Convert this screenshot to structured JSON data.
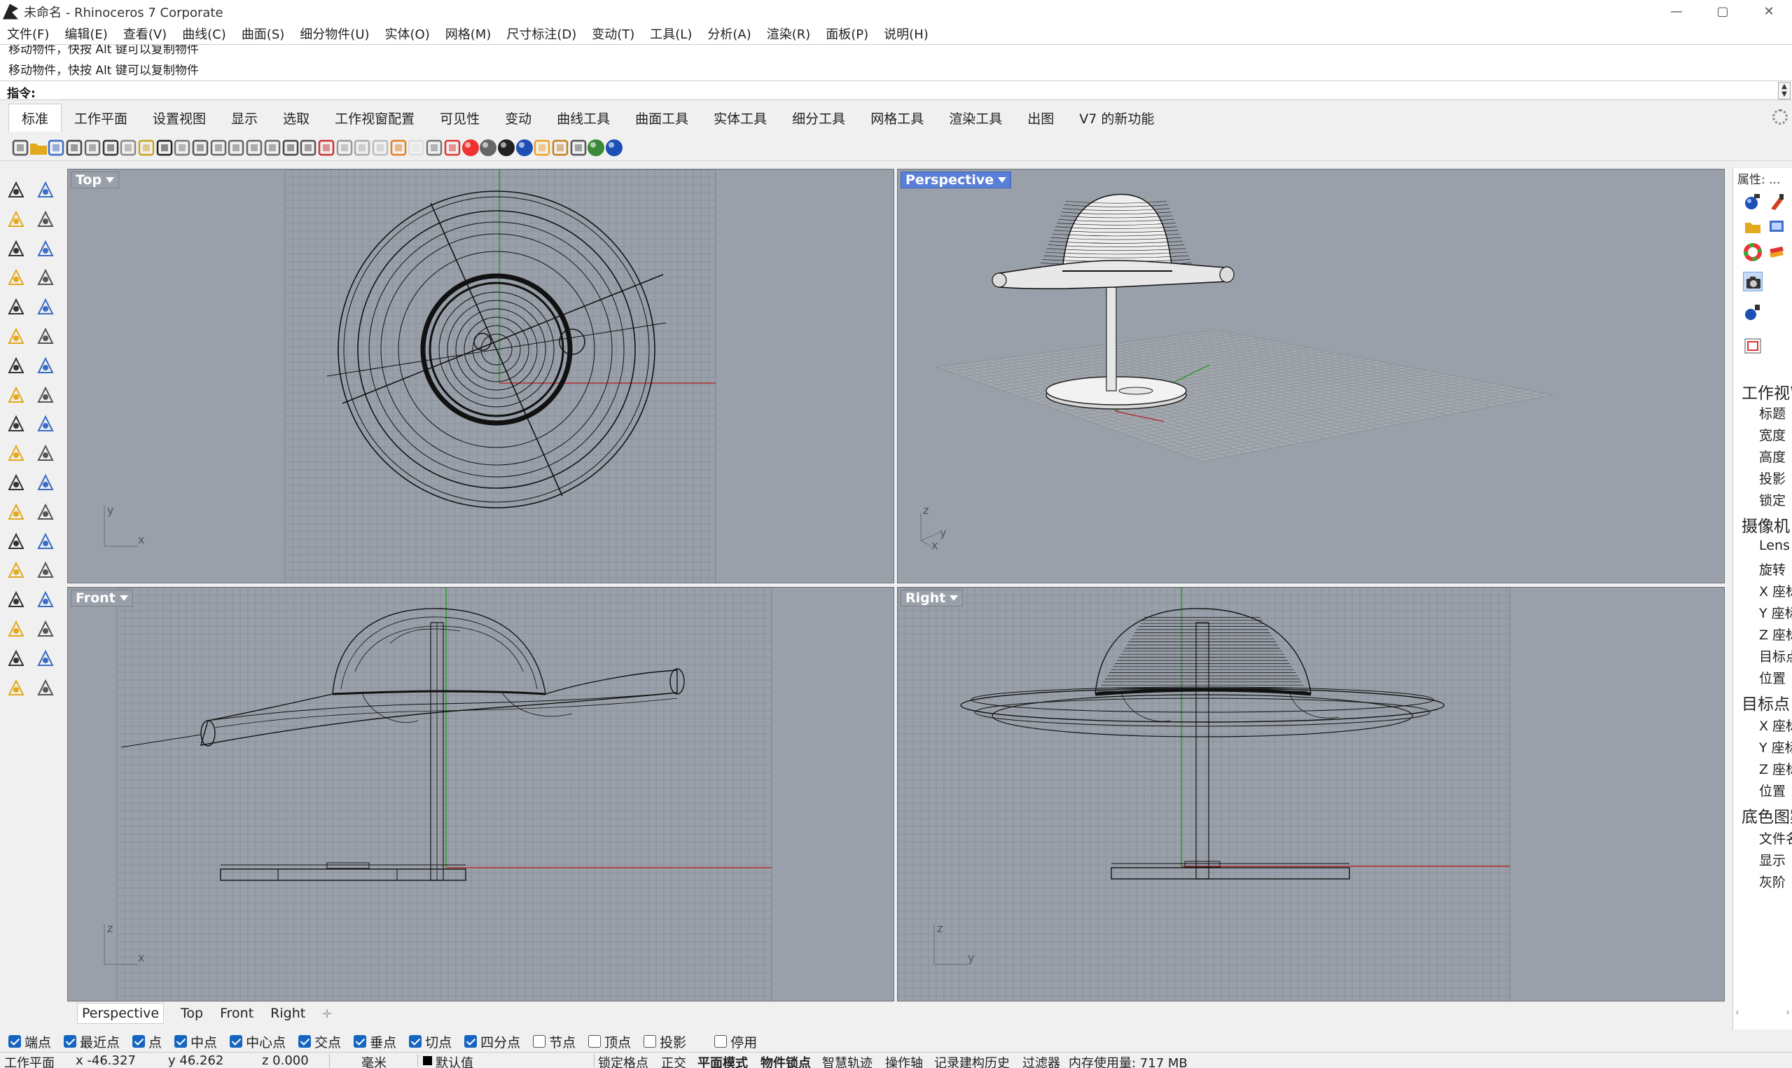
{
  "window": {
    "title": "未命名 - Rhinoceros 7 Corporate",
    "minimize": "—",
    "maximize": "▢",
    "close": "✕"
  },
  "menu": [
    "文件(F)",
    "编辑(E)",
    "查看(V)",
    "曲线(C)",
    "曲面(S)",
    "细分物件(U)",
    "实体(O)",
    "网格(M)",
    "尺寸标注(D)",
    "变动(T)",
    "工具(L)",
    "分析(A)",
    "渲染(R)",
    "面板(P)",
    "说明(H)"
  ],
  "command": {
    "history": [
      "移动物件，快按 Alt 键可以复制物件",
      "移动物件，快按 Alt 键可以复制物件"
    ],
    "prompt_label": "指令:",
    "prompt_value": ""
  },
  "tool_tabs": [
    "标准",
    "工作平面",
    "设置视图",
    "显示",
    "选取",
    "工作视窗配置",
    "可见性",
    "变动",
    "曲线工具",
    "曲面工具",
    "实体工具",
    "细分工具",
    "网格工具",
    "渲染工具",
    "出图",
    "V7 的新功能"
  ],
  "toolbar_icons": [
    "new-file-icon",
    "open-file-icon",
    "save-icon",
    "print-icon",
    "import-icon",
    "cut-icon",
    "copy-icon",
    "paste-icon",
    "undo-icon",
    "pan-icon",
    "rotate-view-icon",
    "zoom-dynamic-icon",
    "zoom-window-icon",
    "zoom-extents-icon",
    "zoom-selected-icon",
    "undo-view-icon",
    "four-view-icon",
    "named-view-icon",
    "construction-plane-icon",
    "snap-grid-icon",
    "select-filter-icon",
    "osnap-icon",
    "light-icon",
    "lock-icon",
    "layer-icon",
    "color-wheel-icon",
    "shaded-sphere-icon",
    "rendered-sphere-icon",
    "render-sphere-icon",
    "flamingo-icon",
    "options-icon",
    "object-properties-icon",
    "globe-icon",
    "help-icon"
  ],
  "left_tool_icons": [
    "select-icon",
    "point-icon",
    "polyline-icon",
    "curve-icon",
    "circle-icon",
    "ellipse-icon",
    "polygon-icon",
    "rectangle-icon",
    "arc-icon",
    "curve-from-object-icon",
    "surface-icon",
    "surface-tools-icon",
    "box-icon",
    "boolean-icon",
    "extrude-icon",
    "plane-icon",
    "explode-icon",
    "fillet-icon",
    "trim-icon",
    "split-icon",
    "group-icon",
    "points-icon",
    "curve-fillet-icon",
    "offset-icon",
    "text-icon",
    "dimension-icon",
    "block-icon",
    "transform-icon",
    "mesh-icon",
    "analysis-icon",
    "array-icon",
    "gumball-icon",
    "record-history-icon",
    "check-icon",
    "solid-tools-icon",
    "render-icon"
  ],
  "viewports": {
    "top": {
      "label": "Top",
      "axis1": "y",
      "axis2": "x"
    },
    "perspective": {
      "label": "Perspective",
      "axis1": "z",
      "axis2": "x",
      "axis3": "y"
    },
    "front": {
      "label": "Front",
      "axis1": "z",
      "axis2": "x"
    },
    "right": {
      "label": "Right",
      "axis1": "z",
      "axis2": "y"
    }
  },
  "properties_panel": {
    "title": "属性: ...",
    "section_viewport": "工作视窗",
    "viewport_fields": [
      "标题",
      "宽度",
      "高度",
      "投影",
      "锁定"
    ],
    "section_camera": "摄像机",
    "camera_fields": [
      "Lens",
      "旋转",
      "X 座标",
      "Y 座标",
      "Z 座标",
      "目标点",
      "位置"
    ],
    "section_target": "目标点",
    "target_fields": [
      "X 座标",
      "Y 座标",
      "Z 座标",
      "位置"
    ],
    "section_wallpaper": "底色图案",
    "wallpaper_fields": [
      "文件名",
      "显示",
      "灰阶"
    ]
  },
  "view_tabs": [
    "Perspective",
    "Top",
    "Front",
    "Right"
  ],
  "view_tab_add": "✛",
  "osnaps": [
    {
      "label": "端点",
      "checked": true
    },
    {
      "label": "最近点",
      "checked": true
    },
    {
      "label": "点",
      "checked": true
    },
    {
      "label": "中点",
      "checked": true
    },
    {
      "label": "中心点",
      "checked": true
    },
    {
      "label": "交点",
      "checked": true
    },
    {
      "label": "垂点",
      "checked": true
    },
    {
      "label": "切点",
      "checked": true
    },
    {
      "label": "四分点",
      "checked": true
    },
    {
      "label": "节点",
      "checked": false
    },
    {
      "label": "顶点",
      "checked": false
    },
    {
      "label": "投影",
      "checked": false
    },
    {
      "label": "停用",
      "checked": false
    }
  ],
  "status": {
    "cplane": "工作平面",
    "x": "x -46.327",
    "y": "y 46.262",
    "z": "z 0.000",
    "units": "毫米",
    "layer": "默认值",
    "grid_snap": "锁定格点",
    "ortho": "正交",
    "planar": "平面模式",
    "osnap": "物件锁点",
    "smarttrack": "智慧轨迹",
    "gumball": "操作轴",
    "history": "记录建构历史",
    "filter": "过滤器",
    "memory": "内存使用量: 717 MB"
  }
}
